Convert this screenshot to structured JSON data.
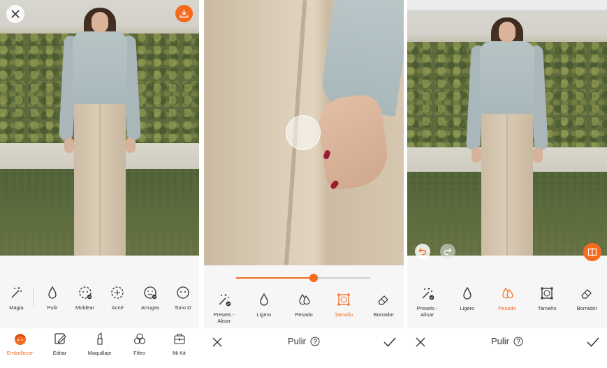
{
  "accent_color": "#f56a1d",
  "panel1": {
    "tools": [
      "Magia",
      "Pulir",
      "Moldear",
      "Acné",
      "Arrugas",
      "Tono D"
    ],
    "nav": [
      {
        "label": "Embellecer",
        "icon": "face-icon",
        "active": true
      },
      {
        "label": "Editar",
        "icon": "edit-icon",
        "active": false
      },
      {
        "label": "Maquillaje",
        "icon": "lipstick-icon",
        "active": false
      },
      {
        "label": "Filtro",
        "icon": "filter-icon",
        "active": false
      },
      {
        "label": "Mi Kit",
        "icon": "kit-icon",
        "active": false
      }
    ]
  },
  "panel2": {
    "slider_value_percent": 58,
    "tools": [
      {
        "label": "Presets - Alisar",
        "active": false
      },
      {
        "label": "Ligero",
        "active": false
      },
      {
        "label": "Pesado",
        "active": false
      },
      {
        "label": "Tamaño",
        "active": true
      },
      {
        "label": "Borrador",
        "active": false
      }
    ],
    "title": "Pulir"
  },
  "panel3": {
    "tools": [
      {
        "label": "Presets - Alisar",
        "active": false
      },
      {
        "label": "Ligero",
        "active": false
      },
      {
        "label": "Pesado",
        "active": true
      },
      {
        "label": "Tamaño",
        "active": false
      },
      {
        "label": "Borrador",
        "active": false
      }
    ],
    "title": "Pulir"
  }
}
